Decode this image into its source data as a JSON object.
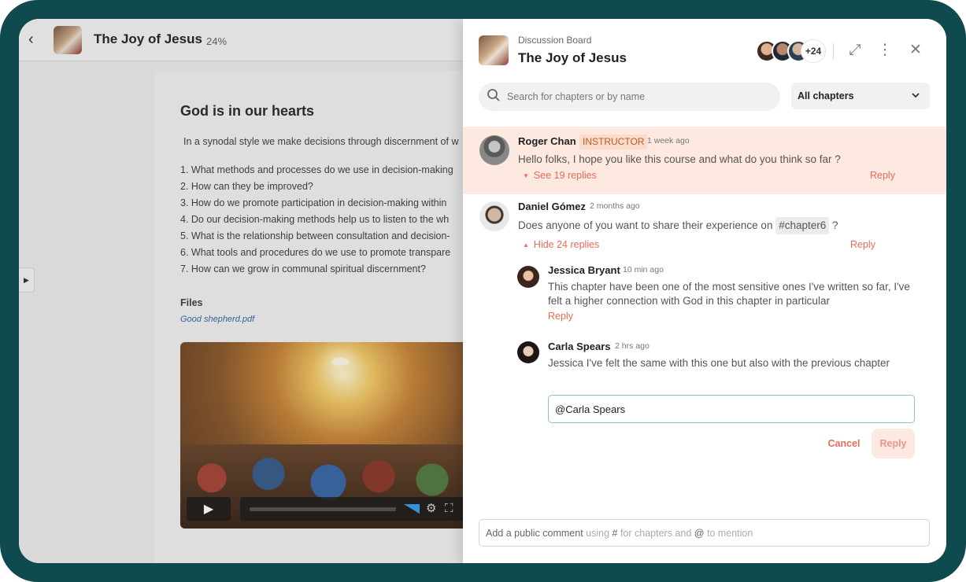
{
  "course": {
    "title": "The Joy of Jesus",
    "progress": "24%",
    "back_icon": "back-arrow-icon"
  },
  "content": {
    "section_title": "God is in our hearts",
    "intro": "In a synodal style we make decisions through discernment of w",
    "questions": [
      "1. What methods and processes do we use in decision-making",
      "2. How can they be improved?",
      "3. How do we promote participation in decision-making within",
      "4. Do our decision-making methods help us to listen to the wh",
      "5. What is the relationship between consultation and decision-",
      "6. What tools and procedures do we use to promote transpare",
      "7. How can we grow in communal spiritual discernment?"
    ],
    "files_label": "Files",
    "file_link": "Good shepherd.pdf"
  },
  "panel": {
    "board_label": "Discussion Board",
    "title": "The Joy of Jesus",
    "participants_more": "+24",
    "search_placeholder": "Search for chapters or by name",
    "filter_selected": "All chapters"
  },
  "threads": [
    {
      "author": "Roger Chan",
      "badge": "INSTRUCTOR",
      "time": "1 week ago",
      "message": "Hello folks, I hope you like this course and what do you think so far ?",
      "toggle": "See 19 replies",
      "reply": "Reply"
    },
    {
      "author": "Daniel Gómez",
      "time": "2 months ago",
      "message_before": "Does anyone of you want to share their experience on ",
      "tag": "#chapter6",
      "message_after": " ?",
      "toggle": "Hide 24 replies",
      "reply": "Reply",
      "replies": [
        {
          "author": "Jessica Bryant",
          "time": "10 min ago",
          "message": "This chapter have been one of the most sensitive ones I've written so far, I've felt a higher connection with God in this chapter in particular",
          "reply": "Reply"
        },
        {
          "author": "Carla Spears",
          "time": "2 hrs ago",
          "message": "Jessica I've felt the same with this one but also with the previous chapter"
        }
      ]
    }
  ],
  "reply_form": {
    "value": "@Carla Spears",
    "cancel_label": "Cancel",
    "submit_label": "Reply"
  },
  "comment": {
    "placeholder_main": "Add a public comment",
    "placeholder_hint_1": " using ",
    "hash": "#",
    "placeholder_hint_2": " for chapters and ",
    "at": "@",
    "placeholder_hint_3": " to mention"
  },
  "colors": {
    "frame": "#0f4a4f",
    "accent": "#e86b59",
    "highlight": "#fde9df",
    "input_focus": "#8ec4bd"
  }
}
